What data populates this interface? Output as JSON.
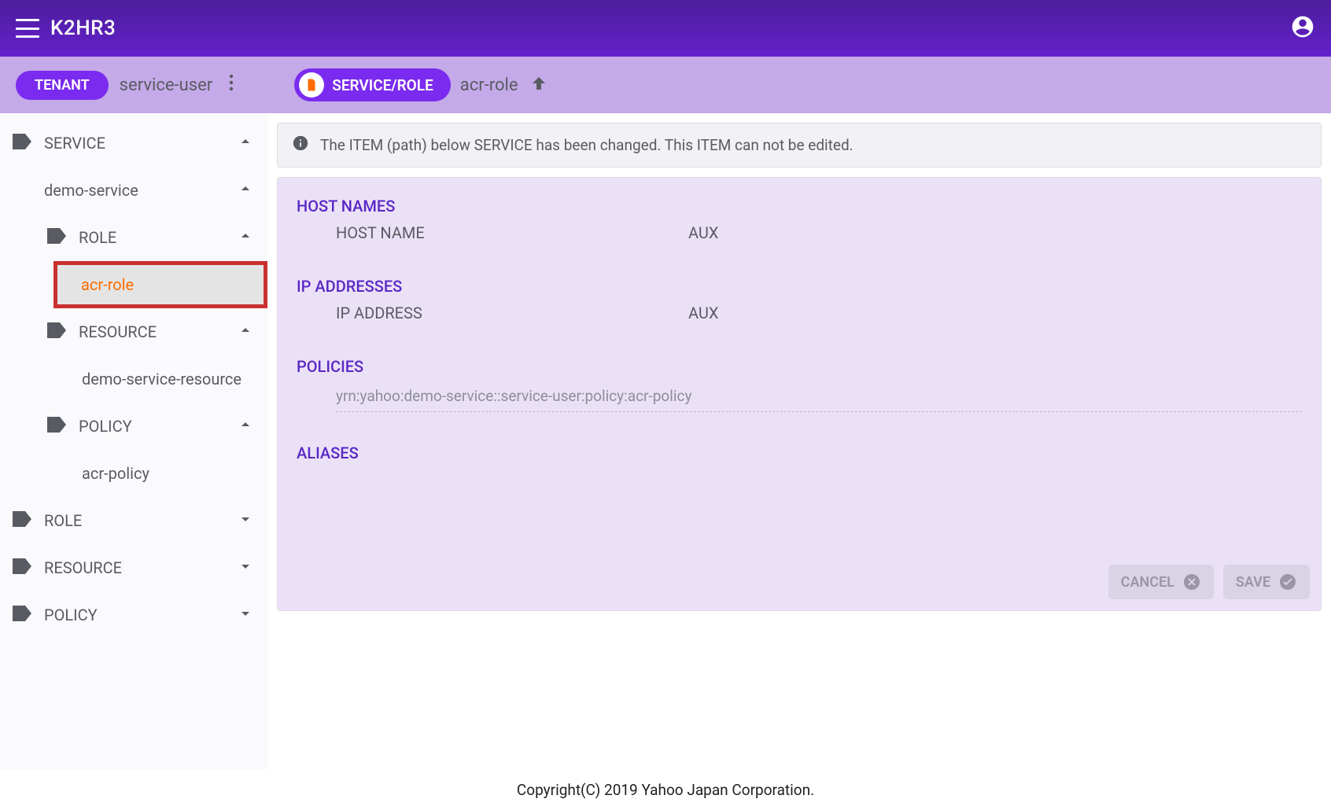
{
  "header": {
    "title": "K2HR3"
  },
  "toolbar": {
    "tenant_chip": "TENANT",
    "tenant_name": "service-user",
    "breadcrumb_chip": "SERVICE/ROLE",
    "breadcrumb_current": "acr-role"
  },
  "sidebar": {
    "service_label": "SERVICE",
    "demo_service_label": "demo-service",
    "role_label": "ROLE",
    "acr_role_label": "acr-role",
    "resource_label": "RESOURCE",
    "demo_service_resource_label": "demo-service-resource",
    "policy_label": "POLICY",
    "acr_policy_label": "acr-policy",
    "root_role_label": "ROLE",
    "root_resource_label": "RESOURCE",
    "root_policy_label": "POLICY"
  },
  "info_text": "The ITEM (path) below SERVICE has been changed. This ITEM can not be edited.",
  "sections": {
    "hostnames_title": "HOST NAMES",
    "hostname_col": "HOST NAME",
    "aux_col": "AUX",
    "ip_title": "IP ADDRESSES",
    "ip_col": "IP ADDRESS",
    "policies_title": "POLICIES",
    "policy_item": "yrn:yahoo:demo-service::service-user:policy:acr-policy",
    "aliases_title": "ALIASES"
  },
  "buttons": {
    "cancel": "CANCEL",
    "save": "SAVE"
  },
  "footer": "Copyright(C) 2019 Yahoo Japan Corporation."
}
